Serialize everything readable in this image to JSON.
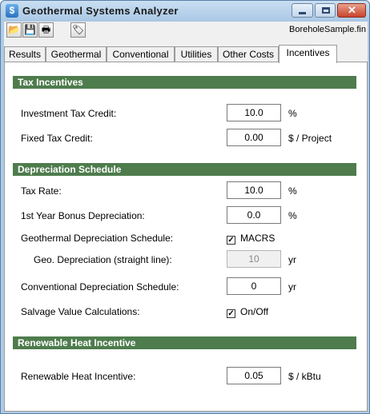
{
  "window": {
    "title": "Geothermal Systems Analyzer",
    "app_icon": "$",
    "close_glyph": "✕"
  },
  "toolbar": {
    "buttons": [
      {
        "icon": "open-folder-icon",
        "glyph": "📂"
      },
      {
        "icon": "save-disk-icon",
        "glyph": "💾"
      },
      {
        "icon": "print-icon",
        "glyph": "🖶"
      },
      {
        "icon": "tag-icon",
        "glyph": "🏷"
      }
    ],
    "filename": "BoreholeSample.fin"
  },
  "tabs": [
    {
      "label": "Results"
    },
    {
      "label": "Geothermal"
    },
    {
      "label": "Conventional"
    },
    {
      "label": "Utilities"
    },
    {
      "label": "Other Costs"
    },
    {
      "label": "Incentives",
      "active": true
    }
  ],
  "tax_incentives": {
    "header": "Tax Incentives",
    "investment_tax_credit": {
      "label": "Investment Tax Credit:",
      "value": "10.0",
      "unit": "%"
    },
    "fixed_tax_credit": {
      "label": "Fixed Tax Credit:",
      "value": "0.00",
      "unit": "$ / Project"
    }
  },
  "depreciation": {
    "header": "Depreciation Schedule",
    "tax_rate": {
      "label": "Tax Rate:",
      "value": "10.0",
      "unit": "%"
    },
    "bonus": {
      "label": "1st Year Bonus Depreciation:",
      "value": "0.0",
      "unit": "%"
    },
    "geo_schedule": {
      "label": "Geothermal Depreciation Schedule:",
      "check_label": "MACRS",
      "checked": true
    },
    "geo_straight": {
      "label": "Geo. Depreciation (straight line):",
      "value": "10",
      "unit": "yr"
    },
    "conv_schedule": {
      "label": "Conventional Depreciation Schedule:",
      "value": "0",
      "unit": "yr"
    },
    "salvage": {
      "label": "Salvage Value Calculations:",
      "check_label": "On/Off",
      "checked": true
    }
  },
  "renewable": {
    "header": "Renewable Heat Incentive",
    "rhi": {
      "label": "Renewable Heat Incentive:",
      "value": "0.05",
      "unit": "$ / kBtu"
    }
  },
  "colors": {
    "section_header": "#4e7c4d",
    "title_bar": "#a9c7e4",
    "close_button": "#c8442c"
  }
}
